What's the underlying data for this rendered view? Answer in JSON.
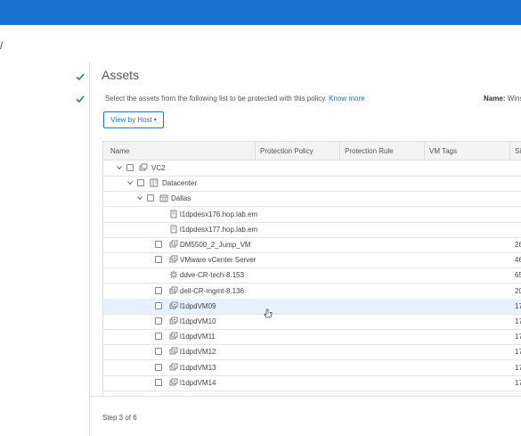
{
  "left_rail_char": "/",
  "section_title": "Assets",
  "description": "Select the assets from the following list to be protected with this policy.",
  "know_more": "Know more",
  "name_label": "Name:",
  "name_value": "Wins",
  "view_button": "View by Host",
  "view_button_caret": "▾",
  "columns": [
    "Name",
    "Protection Policy",
    "Protection Rule",
    "VM Tags",
    "Si"
  ],
  "rows": [
    {
      "label": "VC2",
      "size": "",
      "icon": "vcenter-icon"
    },
    {
      "label": "Datacenter",
      "size": "",
      "icon": "datacenter-icon"
    },
    {
      "label": "Dallas",
      "size": "",
      "icon": "cluster-icon"
    },
    {
      "label": "l1dpdesx176.hop.lab.em",
      "size": "",
      "icon": "host-icon"
    },
    {
      "label": "l1dpdesx177.hop.lab.em",
      "size": "",
      "icon": "host-icon"
    },
    {
      "label": "DM5500_2_Jump_VM",
      "size": "26",
      "icon": "vm-icon"
    },
    {
      "label": "VMware vCenter Server",
      "size": "46",
      "icon": "vm-icon"
    },
    {
      "label": "ddve-CR-tech-8.153",
      "size": "65",
      "icon": "gear-icon"
    },
    {
      "label": "dell-CR-mgmt-8.136",
      "size": "20",
      "icon": "vm-icon"
    },
    {
      "label": "l1dpdVM09",
      "size": "17",
      "icon": "vm-icon"
    },
    {
      "label": "l1dpdVM10",
      "size": "17",
      "icon": "vm-icon"
    },
    {
      "label": "l1dpdVM11",
      "size": "17",
      "icon": "vm-icon"
    },
    {
      "label": "l1dpdVM12",
      "size": "17",
      "icon": "vm-icon"
    },
    {
      "label": "l1dpdVM13",
      "size": "17",
      "icon": "vm-icon"
    },
    {
      "label": "l1dpdVM14",
      "size": "17",
      "icon": "vm-icon"
    }
  ],
  "step": "Step 3 of 6",
  "colors": {
    "brand": "#1a73d1",
    "check": "#2a8a4a",
    "row_highlight": "#e8f0fb"
  }
}
